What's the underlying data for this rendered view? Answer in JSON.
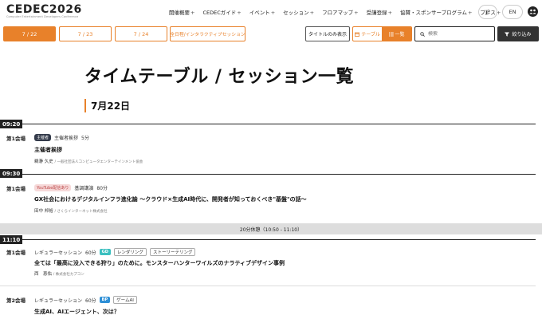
{
  "logo": {
    "main": "CEDEC2026",
    "sub": "Computer Entertainment Developers Conference"
  },
  "nav": [
    {
      "label": "開催概要",
      "plus": "+"
    },
    {
      "label": "CEDECガイド",
      "plus": "+"
    },
    {
      "label": "イベント",
      "plus": "+"
    },
    {
      "label": "セッション",
      "plus": "+"
    },
    {
      "label": "フロアマップ",
      "plus": "+"
    },
    {
      "label": "受講登録",
      "plus": "+"
    },
    {
      "label": "協賛・スポンサープログラム",
      "plus": "+"
    },
    {
      "label": "プレス",
      "plus": "+"
    }
  ],
  "lang": {
    "jp": "JP",
    "en": "EN"
  },
  "toolbar": {
    "dates": [
      "7 / 22",
      "7 / 23",
      "7 / 24",
      "全日程/インタラクティブセッション"
    ],
    "title_only": "タイトルのみ表示",
    "view_table": "テーブル",
    "view_list": "一覧",
    "search_placeholder": "検索",
    "filter": "絞り込み"
  },
  "page_title": "タイムテーブル / セッション一覧",
  "day_heading": "7月22日",
  "times": [
    "09:20",
    "09:30",
    "11:10"
  ],
  "break": "20分休憩（10:50 - 11:10）",
  "sessions": [
    {
      "room": "第1会場",
      "badge": "主催者",
      "type": "主催者挨拶",
      "duration": "5分",
      "title": "主催者挨拶",
      "speaker": "鵜瀞 久史",
      "org": "/ 一般社団法人コンピュータエンターテインメント協会"
    },
    {
      "room": "第1会場",
      "badge": "YouTube配信あり",
      "type": "基調講演",
      "duration": "80分",
      "title": "GX社会におけるデジタルインフラ進化論 ～クラウド×生成AI時代に、開発者が知っておくべき\"基盤\"の話～",
      "speaker": "田中 邦裕",
      "org": "/ さくらインターネット株式会社"
    },
    {
      "room": "第1会場",
      "type": "レギュラーセッション",
      "duration": "60分",
      "category": "GD",
      "category_color": "#3bbfbf",
      "tags": [
        "レンダリング",
        "ストーリーテリング"
      ],
      "title": "全ては「最高に没入できる狩り」のために。モンスターハンターワイルズのナラティブデザイン事例",
      "speaker": "西　恵佑",
      "org": "/ 株式会社カプコン"
    },
    {
      "room": "第2会場",
      "type": "レギュラーセッション",
      "duration": "60分",
      "category": "BP",
      "category_color": "#2e8fd6",
      "tags": [
        "ゲームAI"
      ],
      "title": "生成AI、AIエージェント、次は？"
    }
  ]
}
